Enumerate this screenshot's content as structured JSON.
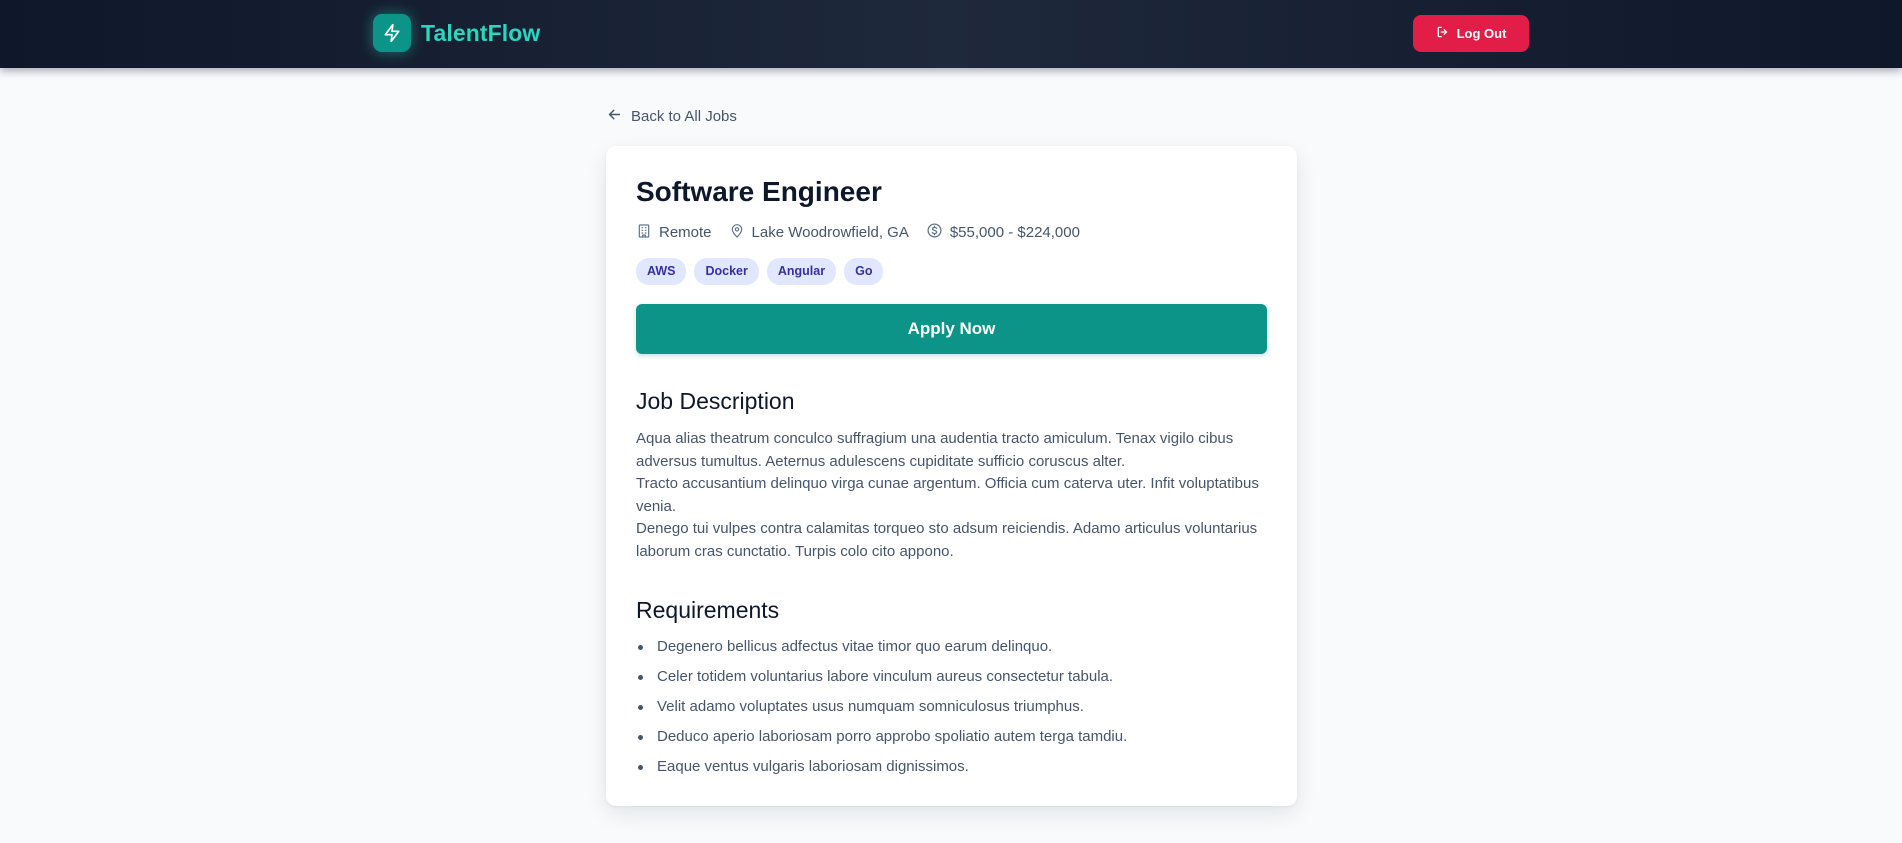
{
  "header": {
    "brand_name": "TalentFlow",
    "brand_icon": "lightning-bolt-icon",
    "logout_label": "Log Out",
    "logout_icon": "log-out-icon"
  },
  "back_link": {
    "label": "Back to All Jobs",
    "icon": "arrow-left-icon"
  },
  "job": {
    "title": "Software Engineer",
    "work_type": "Remote",
    "location": "Lake Woodrowfield, GA",
    "salary": "$55,000 - $224,000",
    "tags": [
      "AWS",
      "Docker",
      "Angular",
      "Go"
    ],
    "apply_label": "Apply Now",
    "description_heading": "Job Description",
    "description": [
      "Aqua alias theatrum conculco suffragium una audentia tracto amiculum. Tenax vigilo cibus adversus tumultus. Aeternus adulescens cupiditate sufficio coruscus alter.",
      "Tracto accusantium delinquo virga cunae argentum. Officia cum caterva uter. Infit voluptatibus venia.",
      "Denego tui vulpes contra calamitas torqueo sto adsum reiciendis. Adamo articulus voluntarius laborum cras cunctatio. Turpis colo cito appono."
    ],
    "requirements_heading": "Requirements",
    "requirements": [
      "Degenero bellicus adfectus vitae timor quo earum delinquo.",
      "Celer totidem voluntarius labore vinculum aureus consectetur tabula.",
      "Velit adamo voluptates usus numquam somniculosus triumphus.",
      "Deduco aperio laboriosam porro approbo spoliatio autem terga tamdiu.",
      "Eaque ventus vulgaris laboriosam dignissimos."
    ]
  },
  "colors": {
    "header_bg": "#0f172a",
    "brand_teal": "#2dd4bf",
    "accent_teal": "#0d9488",
    "logout_red": "#e11d48",
    "tag_bg": "#e0e7ff",
    "tag_text": "#3730a3"
  }
}
